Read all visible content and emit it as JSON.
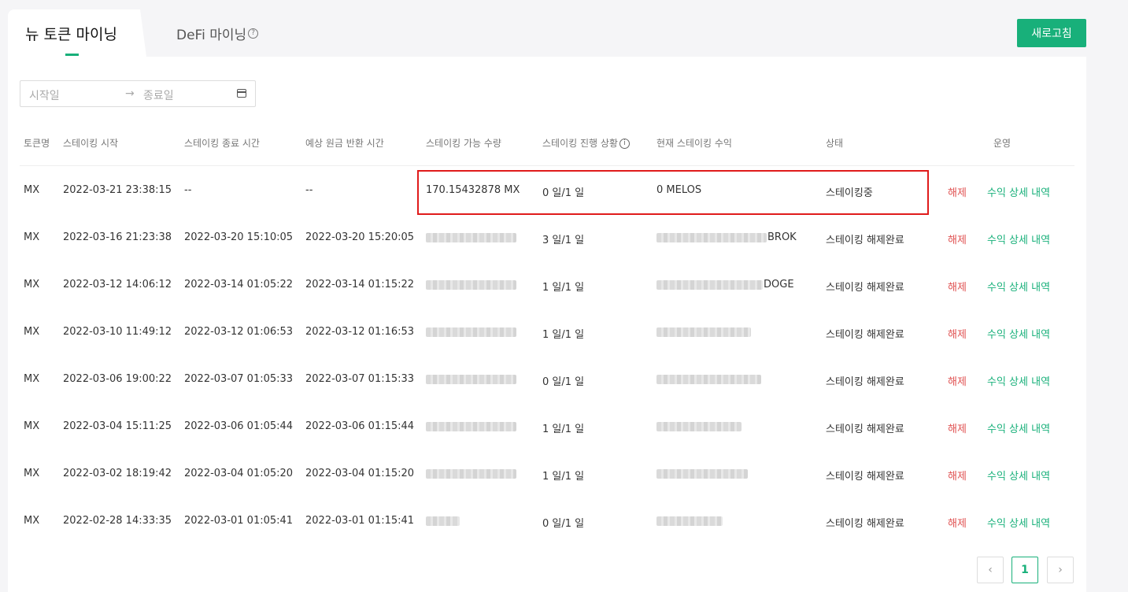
{
  "tabs": {
    "new_token": "뉴 토큰 마이닝",
    "defi": "DeFi 마이닝"
  },
  "refresh_label": "새로고침",
  "date_range": {
    "start_placeholder": "시작일",
    "arrow": "→",
    "end_placeholder": "종료일"
  },
  "columns": [
    "토큰명",
    "스테이킹 시작",
    "스테이킹 종료 시간",
    "예상 원금 반환 시간",
    "스테이킹 가능 수량",
    "스테이킹 진행 상황",
    "현재 스테이킹 수익",
    "상태",
    "운영"
  ],
  "actions": {
    "release": "해제",
    "detail": "수익 상세 내역"
  },
  "rows": [
    {
      "token": "MX",
      "start": "2022-03-21 23:38:15",
      "end": "--",
      "return": "--",
      "amount": "170.15432878 MX",
      "progress": "0 일/1 일",
      "earnings": "0 MELOS",
      "status": "스테이킹중"
    },
    {
      "token": "MX",
      "start": "2022-03-16 21:23:38",
      "end": "2022-03-20 15:10:05",
      "return": "2022-03-20 15:20:05",
      "amount": "",
      "progress": "3 일/1 일",
      "earnings": "BROK",
      "status": "스테이킹 해제완료"
    },
    {
      "token": "MX",
      "start": "2022-03-12 14:06:12",
      "end": "2022-03-14 01:05:22",
      "return": "2022-03-14 01:15:22",
      "amount": "",
      "progress": "1 일/1 일",
      "earnings": "DOGE",
      "status": "스테이킹 해제완료"
    },
    {
      "token": "MX",
      "start": "2022-03-10 11:49:12",
      "end": "2022-03-12 01:06:53",
      "return": "2022-03-12 01:16:53",
      "amount": "",
      "progress": "1 일/1 일",
      "earnings": "",
      "status": "스테이킹 해제완료"
    },
    {
      "token": "MX",
      "start": "2022-03-06 19:00:22",
      "end": "2022-03-07 01:05:33",
      "return": "2022-03-07 01:15:33",
      "amount": "",
      "progress": "0 일/1 일",
      "earnings": "",
      "status": "스테이킹 해제완료"
    },
    {
      "token": "MX",
      "start": "2022-03-04 15:11:25",
      "end": "2022-03-06 01:05:44",
      "return": "2022-03-06 01:15:44",
      "amount": "",
      "progress": "1 일/1 일",
      "earnings": "",
      "status": "스테이킹 해제완료"
    },
    {
      "token": "MX",
      "start": "2022-03-02 18:19:42",
      "end": "2022-03-04 01:05:20",
      "return": "2022-03-04 01:15:20",
      "amount": "",
      "progress": "1 일/1 일",
      "earnings": "",
      "status": "스테이킹 해제완료"
    },
    {
      "token": "MX",
      "start": "2022-02-28 14:33:35",
      "end": "2022-03-01 01:05:41",
      "return": "2022-03-01 01:15:41",
      "amount": "",
      "progress": "0 일/1 일",
      "earnings": "",
      "status": "스테이킹 해제완료"
    }
  ],
  "pagination": {
    "prev": "‹",
    "current": "1",
    "next": "›"
  }
}
